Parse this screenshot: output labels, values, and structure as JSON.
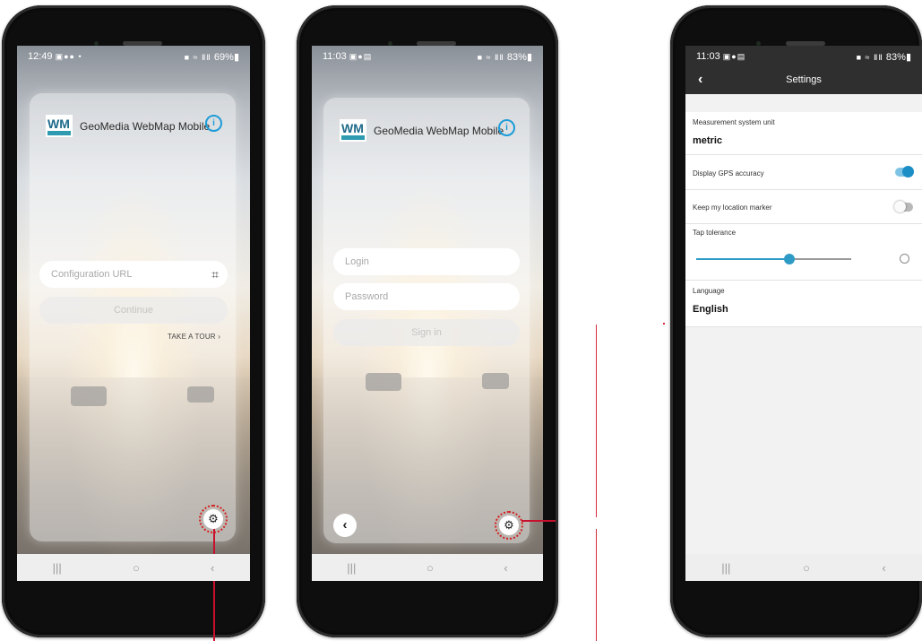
{
  "phone1": {
    "status": {
      "time": "12:49",
      "left_icons": "▣●● •",
      "right_icons": "■ ≈ ⅡⅡ",
      "battery": "69%▮"
    },
    "brand": {
      "logo": "WM",
      "title": "GeoMedia WebMap Mobile"
    },
    "config_url_placeholder": "Configuration URL",
    "continue_label": "Continue",
    "tour_label": "TAKE A TOUR ›",
    "nav": [
      "|||",
      "○",
      "‹"
    ]
  },
  "phone2": {
    "status": {
      "time": "11:03",
      "left_icons": "▣●▤",
      "right_icons": "■ ≈ ⅡⅡ",
      "battery": "83%▮"
    },
    "brand": {
      "logo": "WM",
      "title": "GeoMedia WebMap Mobile"
    },
    "login_placeholder": "Login",
    "password_placeholder": "Password",
    "signin_label": "Sign in",
    "nav": [
      "|||",
      "○",
      "‹"
    ]
  },
  "phone3": {
    "status": {
      "time": "11:03",
      "left_icons": "▣●▤",
      "right_icons": "■ ≈ ⅡⅡ",
      "battery": "83%▮"
    },
    "header_title": "Settings",
    "settings": {
      "measurement_label": "Measurement system unit",
      "measurement_value": "metric",
      "gps_label": "Display GPS accuracy",
      "gps_on": true,
      "keep_marker_label": "Keep my location marker",
      "keep_marker_on": false,
      "tap_tolerance_label": "Tap tolerance",
      "tap_tolerance_fraction": 0.6,
      "language_label": "Language",
      "language_value": "English"
    },
    "nav": [
      "|||",
      "○",
      "‹"
    ]
  },
  "icons": {
    "info": "info-icon",
    "qr": "qr-scan-icon",
    "gear": "gear-icon",
    "back": "chevron-left-icon",
    "nav_recent": "recent-apps-icon",
    "nav_home": "home-icon",
    "nav_back": "back-icon"
  },
  "colors": {
    "accent": "#1c9cd8",
    "toggle_on": "#1c8ec6",
    "callout": "#c8102e",
    "toolbar": "#2f2f2f"
  }
}
